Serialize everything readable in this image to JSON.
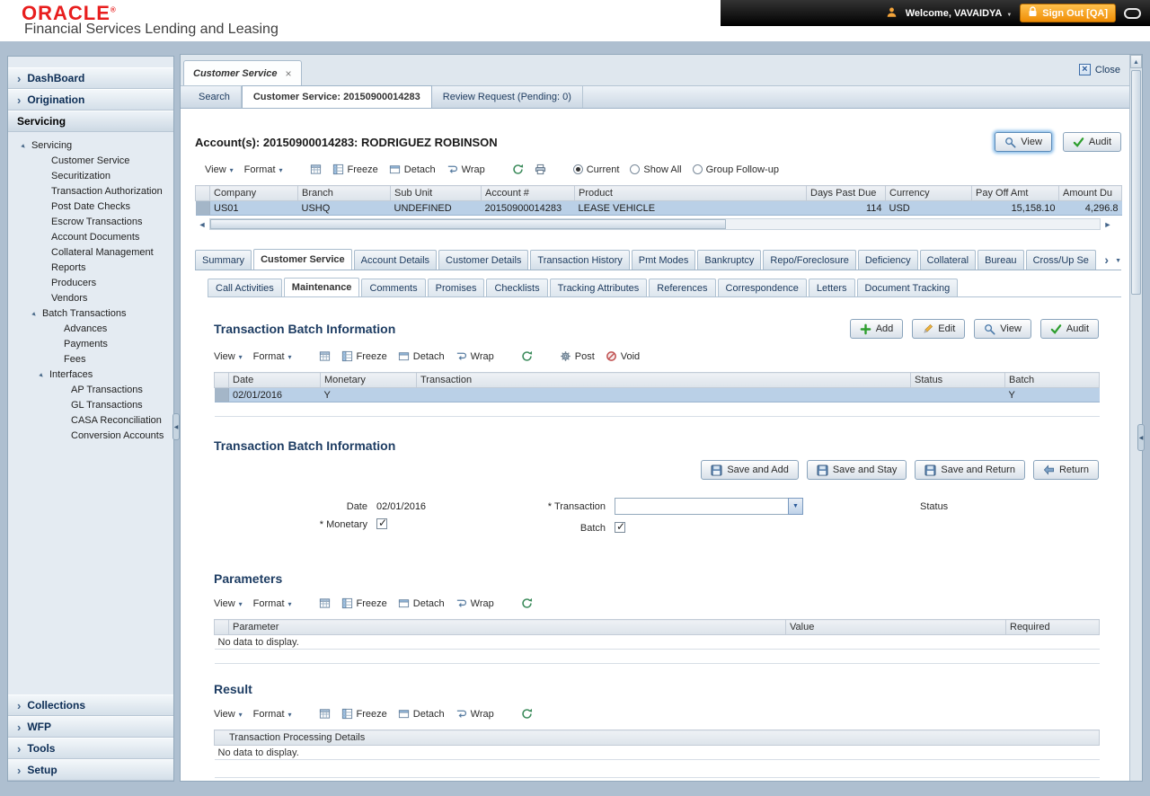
{
  "header": {
    "logo": "ORACLE",
    "reg": "®",
    "app_title": "Financial Services Lending and Leasing",
    "welcome": "Welcome, VAVAIDYA",
    "sign_out": "Sign Out [QA]"
  },
  "sidebar": {
    "menus_top": [
      {
        "label": "DashBoard"
      },
      {
        "label": "Origination"
      },
      {
        "label": "Servicing",
        "active": true
      }
    ],
    "tree": [
      {
        "label": "Servicing",
        "children": [
          {
            "label": "Customer Service"
          },
          {
            "label": "Securitization"
          },
          {
            "label": "Transaction Authorization"
          },
          {
            "label": "Post Date Checks"
          },
          {
            "label": "Escrow Transactions"
          },
          {
            "label": "Account Documents"
          },
          {
            "label": "Collateral Management"
          },
          {
            "label": "Reports"
          },
          {
            "label": "Producers"
          },
          {
            "label": "Vendors"
          }
        ]
      },
      {
        "label": "Batch Transactions",
        "children": [
          {
            "label": "Advances"
          },
          {
            "label": "Payments"
          },
          {
            "label": "Fees"
          }
        ]
      },
      {
        "label": "Interfaces",
        "children": [
          {
            "label": "AP Transactions"
          },
          {
            "label": "GL Transactions"
          },
          {
            "label": "CASA Reconciliation"
          },
          {
            "label": "Conversion Accounts"
          }
        ]
      }
    ],
    "menus_bottom": [
      {
        "label": "Collections"
      },
      {
        "label": "WFP"
      },
      {
        "label": "Tools"
      },
      {
        "label": "Setup"
      }
    ]
  },
  "window": {
    "tab": "Customer Service",
    "close": "Close"
  },
  "doc_tabs": [
    {
      "label": "Search"
    },
    {
      "label": "Customer Service: 20150900014283",
      "active": true
    },
    {
      "label": "Review Request (Pending: 0)"
    }
  ],
  "toolbar_labels": {
    "view": "View",
    "format": "Format",
    "freeze": "Freeze",
    "detach": "Detach",
    "wrap": "Wrap",
    "post": "Post",
    "void": "Void"
  },
  "account": {
    "title": "Account(s): 20150900014283: RODRIGUEZ ROBINSON",
    "view_button": "View",
    "audit_button": "Audit",
    "filters": [
      {
        "label": "Current",
        "selected": true
      },
      {
        "label": "Show All",
        "selected": false
      },
      {
        "label": "Group Follow-up",
        "selected": false
      }
    ],
    "grid": {
      "columns": [
        "Company",
        "Branch",
        "Sub Unit",
        "Account #",
        "Product",
        "Days Past Due",
        "Currency",
        "Pay Off Amt",
        "Amount Du"
      ],
      "row": {
        "selected": true,
        "company": "US01",
        "branch": "USHQ",
        "sub_unit": "UNDEFINED",
        "account_no": "20150900014283",
        "product": "LEASE VEHICLE",
        "days_past_due": "114",
        "currency": "USD",
        "pay_off_amt": "15,158.10",
        "amount_due": "4,296.8"
      }
    }
  },
  "main_tabs": [
    {
      "label": "Summary"
    },
    {
      "label": "Customer Service",
      "active": true
    },
    {
      "label": "Account Details"
    },
    {
      "label": "Customer Details"
    },
    {
      "label": "Transaction History"
    },
    {
      "label": "Pmt Modes"
    },
    {
      "label": "Bankruptcy"
    },
    {
      "label": "Repo/Foreclosure"
    },
    {
      "label": "Deficiency"
    },
    {
      "label": "Collateral"
    },
    {
      "label": "Bureau"
    },
    {
      "label": "Cross/Up Se"
    }
  ],
  "sub_tabs": [
    {
      "label": "Call Activities"
    },
    {
      "label": "Maintenance",
      "active": true
    },
    {
      "label": "Comments"
    },
    {
      "label": "Promises"
    },
    {
      "label": "Checklists"
    },
    {
      "label": "Tracking Attributes"
    },
    {
      "label": "References"
    },
    {
      "label": "Correspondence"
    },
    {
      "label": "Letters"
    },
    {
      "label": "Document Tracking"
    }
  ],
  "batch_grid": {
    "title": "Transaction Batch Information",
    "add_button": "Add",
    "edit_button": "Edit",
    "view_button": "View",
    "audit_button": "Audit",
    "columns": [
      "Date",
      "Monetary",
      "Transaction",
      "Status",
      "Batch"
    ],
    "row": {
      "selected": true,
      "date": "02/01/2016",
      "monetary": "Y",
      "transaction": "",
      "status": "",
      "batch": "Y"
    }
  },
  "batch_form": {
    "title": "Transaction Batch Information",
    "save_add_button": "Save and Add",
    "save_stay_button": "Save and Stay",
    "save_return_button": "Save and Return",
    "return_button": "Return",
    "required_marker": "*",
    "date_label": "Date",
    "date_value": "02/01/2016",
    "monetary_label": "Monetary",
    "monetary_checked": true,
    "transaction_label": "Transaction",
    "transaction_value": "",
    "batch_label": "Batch",
    "batch_checked": true,
    "status_label": "Status",
    "status_value": ""
  },
  "parameters": {
    "title": "Parameters",
    "columns": [
      "Parameter",
      "Value",
      "Required"
    ],
    "empty_text": "No data to display."
  },
  "result": {
    "title": "Result",
    "columns": [
      "Transaction Processing Details"
    ],
    "empty_text": "No data to display."
  },
  "colors": {
    "oracle_red": "#e81e1e",
    "signout_orange": "#ef8d05",
    "selected_row": "#bad0e7",
    "heading_navy": "#1e3d63"
  }
}
